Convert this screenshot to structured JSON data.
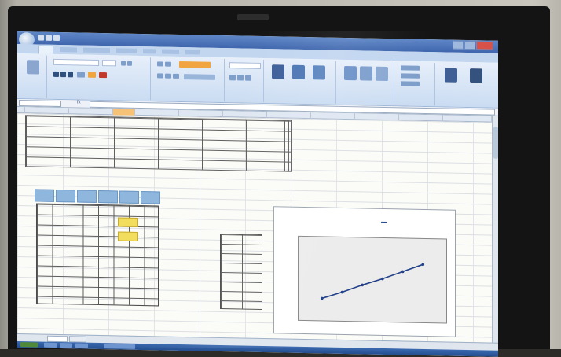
{
  "chart_data": {
    "type": "line",
    "title": "",
    "xlabel": "",
    "ylabel": "",
    "x": [
      1,
      2,
      3,
      4,
      5,
      6
    ],
    "series": [
      {
        "values": [
          2.0,
          2.7,
          3.5,
          4.2,
          5.0,
          5.8
        ]
      }
    ],
    "xlim": [
      0,
      7
    ],
    "ylim": [
      0,
      8
    ],
    "grid": false,
    "legend": "top-right"
  },
  "colors": {
    "series_line": "#23418a",
    "header_band": "#8fb6dd",
    "highlight": "#f2dd5e",
    "ribbon": "#cadcf2"
  }
}
